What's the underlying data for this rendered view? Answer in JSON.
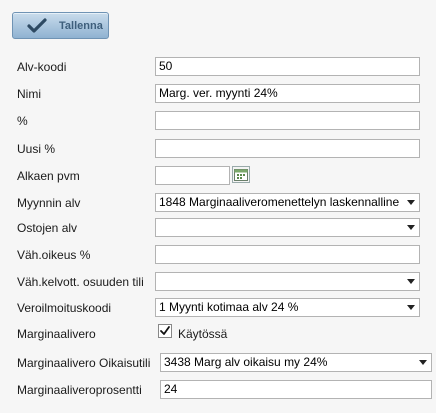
{
  "toolbar": {
    "save_label": "Tallenna",
    "save_icon": "checkmark-icon"
  },
  "form": {
    "alv_koodi": {
      "label": "Alv-koodi",
      "value": "50"
    },
    "nimi": {
      "label": "Nimi",
      "value": "Marg. ver. myynti 24%"
    },
    "prosentti": {
      "label": "%",
      "value": ""
    },
    "uusi_prosentti": {
      "label": "Uusi %",
      "value": ""
    },
    "alkaen_pvm": {
      "label": "Alkaen pvm",
      "value": "",
      "icon": "calendar-icon"
    },
    "myynnin_alv": {
      "label": "Myynnin alv",
      "value": "1848 Marginaaliveromenettelyn laskennalline"
    },
    "ostojen_alv": {
      "label": "Ostojen alv",
      "value": ""
    },
    "vah_oikeus": {
      "label": "Väh.oikeus %",
      "value": ""
    },
    "vah_kelvott": {
      "label": "Väh.kelvott. osuuden tili",
      "value": ""
    },
    "veroilmoituskoodi": {
      "label": "Veroilmoituskoodi",
      "value": "1 Myynti kotimaa alv 24 %"
    },
    "marginaalivero": {
      "label": "Marginaalivero",
      "checked": true,
      "checkbox_label": "Käytössä"
    },
    "marginaalivero_oikaisutili": {
      "label": "Marginaalivero Oikaisutili",
      "value": "3438 Marg alv oikaisu my 24%"
    },
    "marginaaliveroprosentti": {
      "label": "Marginaaliveroprosentti",
      "value": "24"
    }
  }
}
